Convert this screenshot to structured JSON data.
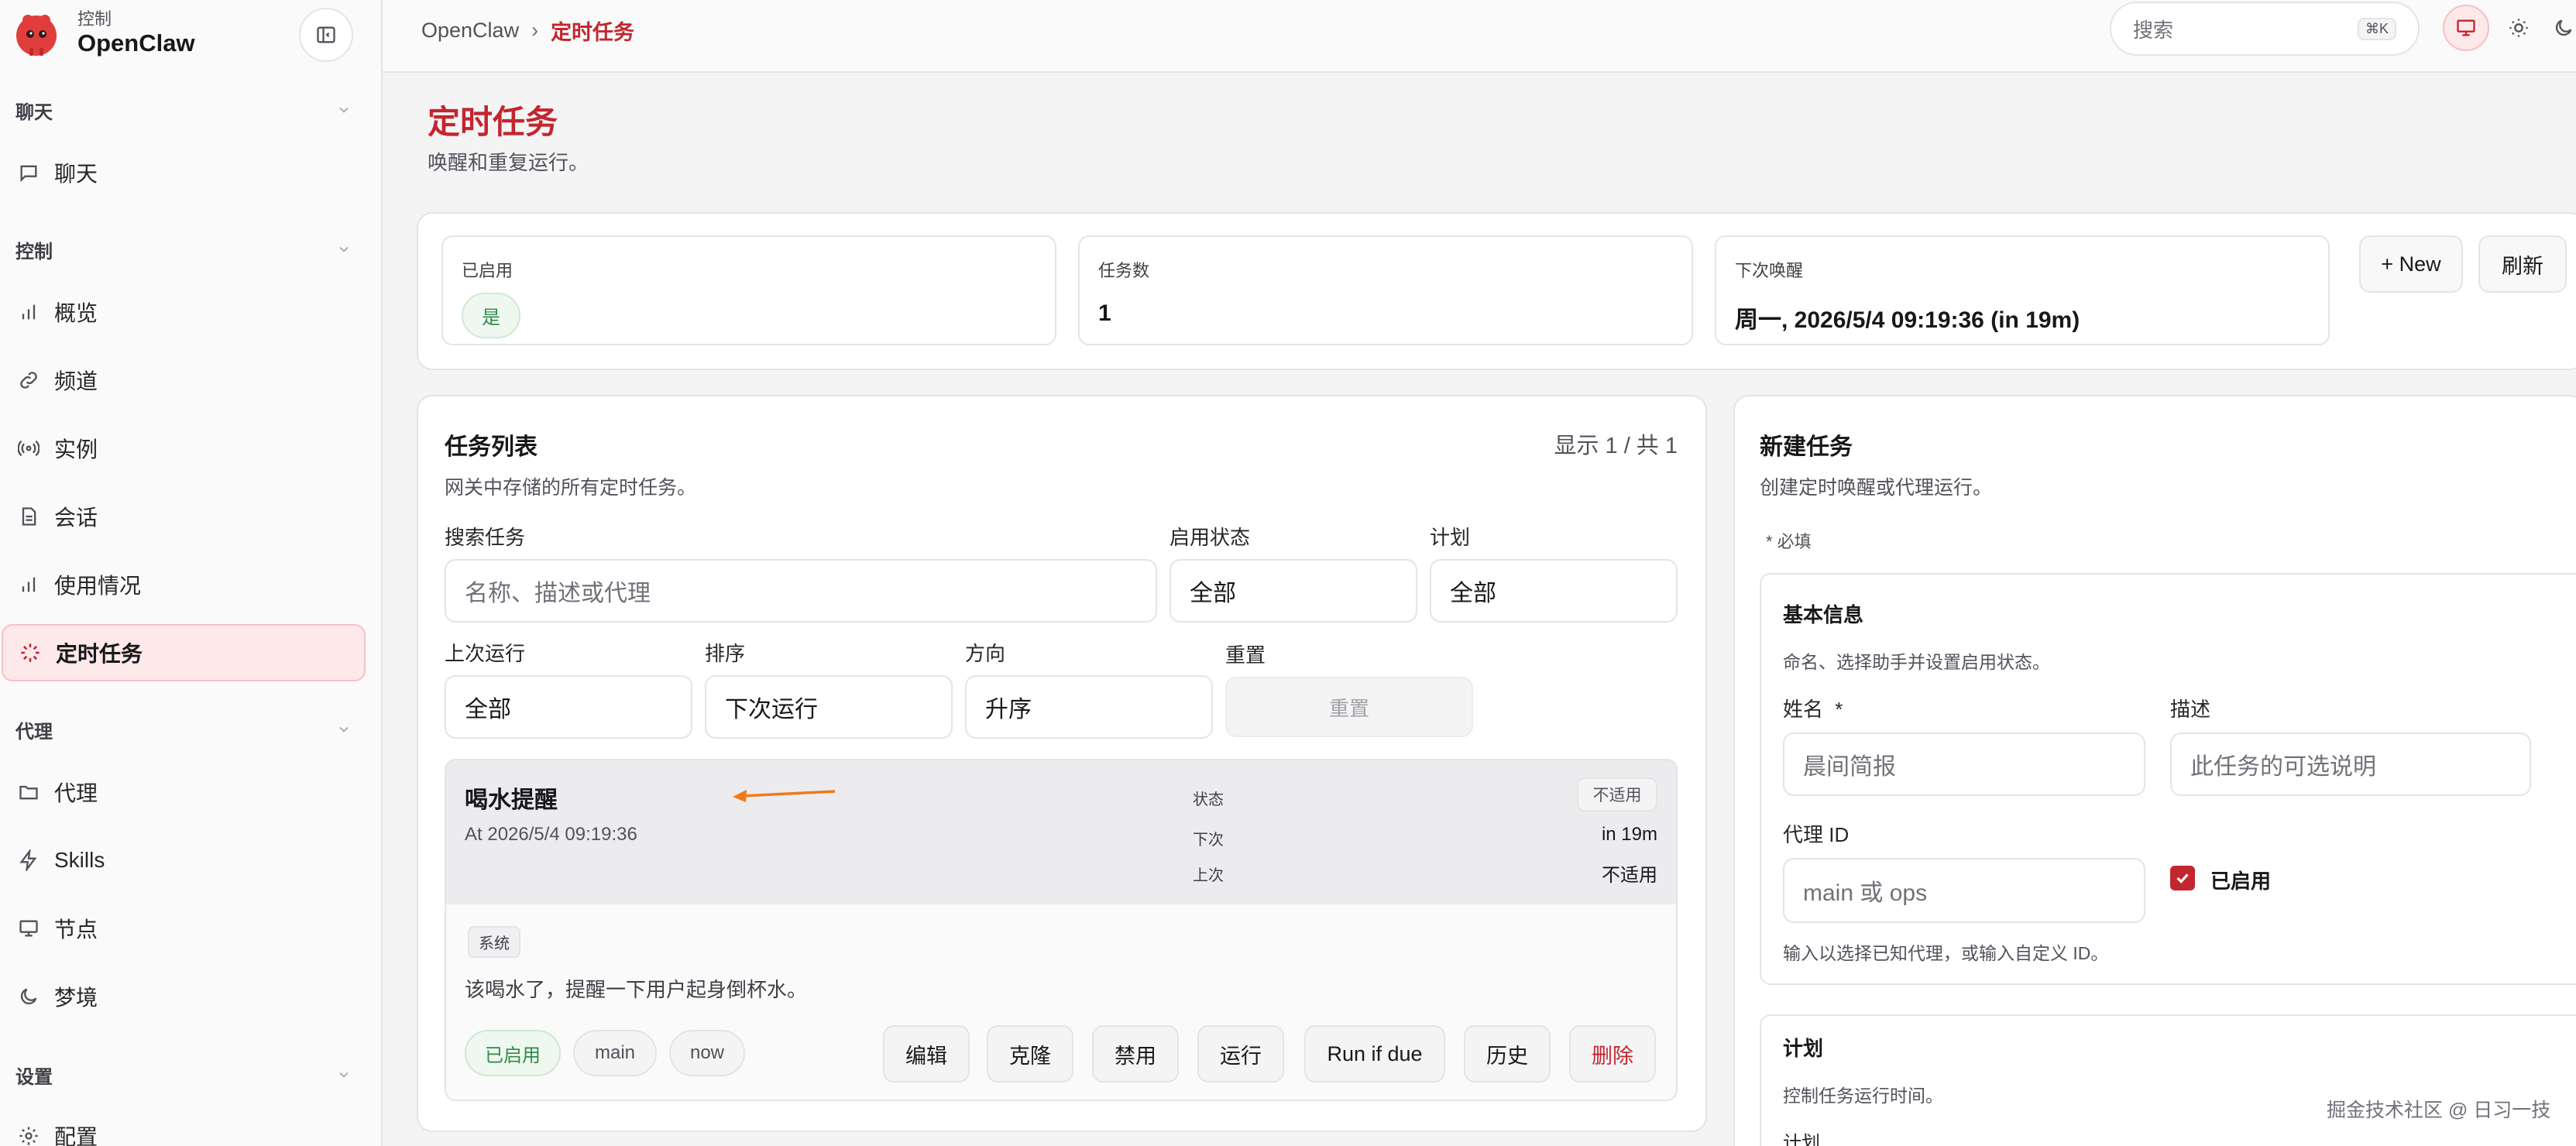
{
  "brand": {
    "kicker": "控制",
    "name": "OpenClaw"
  },
  "sidebar": {
    "sections": [
      {
        "label": "聊天"
      },
      {
        "label": "控制"
      },
      {
        "label": "代理"
      },
      {
        "label": "设置"
      }
    ],
    "items": [
      {
        "label": "聊天",
        "icon": "message-icon"
      },
      {
        "label": "概览",
        "icon": "bar-chart-icon"
      },
      {
        "label": "频道",
        "icon": "link-icon"
      },
      {
        "label": "实例",
        "icon": "radio-icon"
      },
      {
        "label": "会话",
        "icon": "document-icon"
      },
      {
        "label": "使用情况",
        "icon": "bar-chart-icon"
      },
      {
        "label": "定时任务",
        "icon": "spinner-icon",
        "active": true
      },
      {
        "label": "代理",
        "icon": "folder-icon"
      },
      {
        "label": "Skills",
        "icon": "lightning-icon"
      },
      {
        "label": "节点",
        "icon": "monitor-icon"
      },
      {
        "label": "梦境",
        "icon": "moon-icon"
      },
      {
        "label": "配置",
        "icon": "gear-icon"
      }
    ]
  },
  "topbar": {
    "breadcrumb_root": "OpenClaw",
    "breadcrumb_sep": "›",
    "breadcrumb_current": "定时任务",
    "search_placeholder": "搜索",
    "search_shortcut": "⌘K"
  },
  "page": {
    "title": "定时任务",
    "subtitle": "唤醒和重复运行。"
  },
  "stats": {
    "enabled_label": "已启用",
    "enabled_value": "是",
    "jobs_label": "任务数",
    "jobs_value": "1",
    "next_label": "下次唤醒",
    "next_value": "周一, 2026/5/4 09:19:36 (in 19m)",
    "new_button": "+ New",
    "refresh_button": "刷新"
  },
  "job_list": {
    "title": "任务列表",
    "count": "显示 1 / 共 1",
    "subtitle": "网关中存储的所有定时任务。",
    "search_label": "搜索任务",
    "search_placeholder": "名称、描述或代理",
    "enabled_filter_label": "启用状态",
    "enabled_filter_value": "全部",
    "schedule_filter_label": "计划",
    "schedule_filter_value": "全部",
    "last_run_label": "上次运行",
    "last_run_value": "全部",
    "sort_label": "排序",
    "sort_value": "下次运行",
    "direction_label": "方向",
    "direction_value": "升序",
    "reset_label": "重置",
    "reset_button": "重置"
  },
  "job": {
    "name": "喝水提醒",
    "schedule": "At 2026/5/4 09:19:36",
    "status_key": "状态",
    "status_value": "不适用",
    "next_key": "下次",
    "next_value": "in 19m",
    "last_key": "上次",
    "last_value": "不适用",
    "tag": "系统",
    "description": "该喝水了，提醒一下用户起身倒杯水。",
    "chips": [
      "已启用",
      "main",
      "now"
    ],
    "actions": [
      "编辑",
      "克隆",
      "禁用",
      "运行",
      "Run if due",
      "历史",
      "删除"
    ]
  },
  "new_job": {
    "title": "新建任务",
    "subtitle": "创建定时唤醒或代理运行。",
    "required_note": "* 必填",
    "basic_title": "基本信息",
    "basic_sub": "命名、选择助手并设置启用状态。",
    "name_label": "姓名",
    "name_required": "*",
    "name_placeholder": "晨间简报",
    "desc_label": "描述",
    "desc_placeholder": "此任务的可选说明",
    "agent_label": "代理 ID",
    "agent_placeholder": "main 或 ops",
    "enabled_check": "已启用",
    "agent_hint": "输入以选择已知代理，或输入自定义 ID。",
    "plan_title": "计划",
    "plan_sub": "控制任务运行时间。",
    "plan_field_label": "计划"
  },
  "watermark": "掘金技术社区 @ 日习一技",
  "colors": {
    "accent": "#c2262e",
    "success": "#2f8a46",
    "arrow": "#f07a1a"
  }
}
